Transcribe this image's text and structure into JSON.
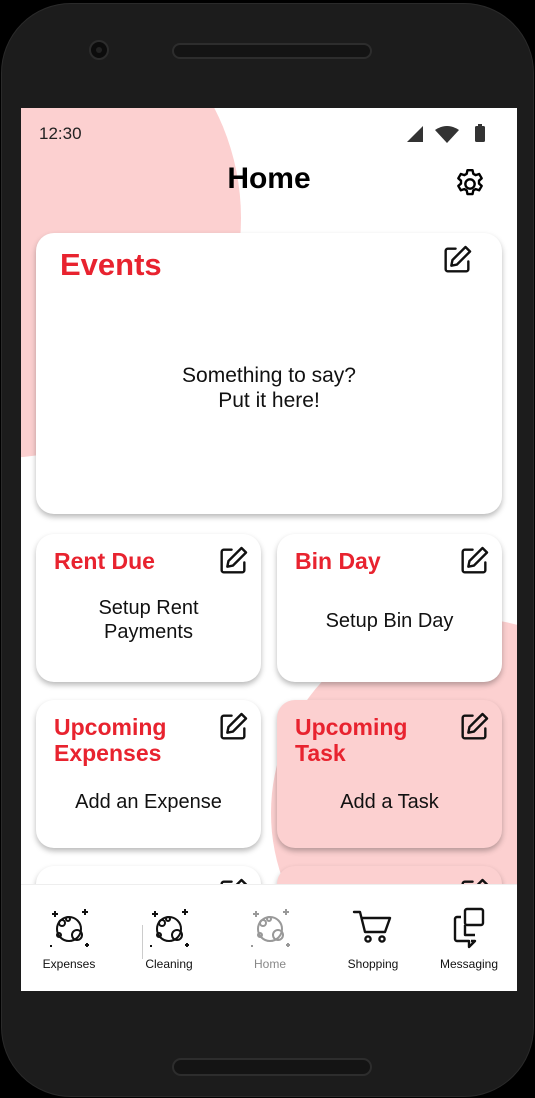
{
  "status": {
    "time": "12:30"
  },
  "header": {
    "title": "Home"
  },
  "cards": {
    "events": {
      "title": "Events",
      "body_line1": "Something to say?",
      "body_line2": "Put it here!"
    },
    "rent": {
      "title": "Rent Due",
      "body_line1": "Setup Rent",
      "body_line2": "Payments"
    },
    "bin": {
      "title": "Bin Day",
      "body": "Setup Bin Day"
    },
    "expenses": {
      "title_line1": "Upcoming",
      "title_line2": "Expenses",
      "body": "Add an Expense"
    },
    "task": {
      "title_line1": "Upcoming",
      "title_line2": "Task",
      "body": "Add a Task"
    }
  },
  "nav": {
    "items": [
      {
        "label": "Expenses",
        "icon": "bubbles-icon"
      },
      {
        "label": "Cleaning",
        "icon": "bubbles-icon"
      },
      {
        "label": "Home",
        "icon": "bubbles-icon",
        "active": true
      },
      {
        "label": "Shopping",
        "icon": "cart-icon"
      },
      {
        "label": "Messaging",
        "icon": "messaging-icon"
      }
    ]
  },
  "colors": {
    "accent": "#e8232f",
    "blob": "#fcd0d0",
    "active_nav": "#888888"
  }
}
